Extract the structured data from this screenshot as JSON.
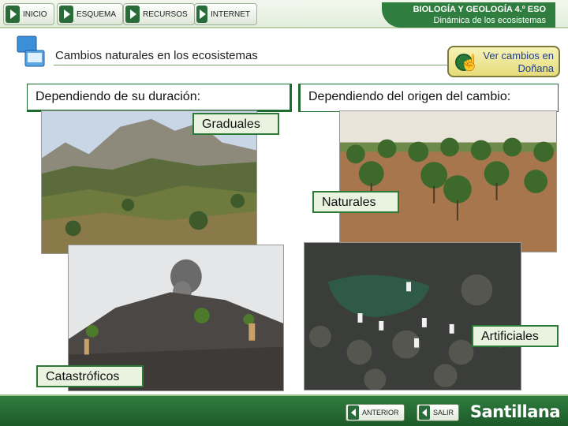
{
  "nav": {
    "inicio": "INICIO",
    "esquema": "ESQUEMA",
    "recursos": "RECURSOS",
    "internet": "INTERNET"
  },
  "course": {
    "subject": "BIOLOGÍA Y GEOLOGÍA 4.º ESO",
    "unit": "Dinámica de los ecosistemas"
  },
  "section": {
    "title": "Cambios naturales en los ecosistemas",
    "ver_button_line1": "Ver cambios en",
    "ver_button_line2": "Doñana"
  },
  "headings": {
    "left": "Dependiendo de su duración:",
    "right": "Dependiendo del origen del cambio:"
  },
  "tags": {
    "graduales": "Graduales",
    "naturales": "Naturales",
    "artificiales": "Artificiales",
    "catastroficos": "Catastróficos"
  },
  "footer": {
    "anterior": "ANTERIOR",
    "salir": "SALIR",
    "brand": "Santillana"
  },
  "icons": {
    "play": "play-icon",
    "hand": "hand-pointer-icon",
    "monitor": "monitor-icon"
  },
  "colors": {
    "accent_green": "#2f7d3f",
    "tag_bg": "#e9f3df",
    "button_yellow": "#e6dc7a"
  }
}
